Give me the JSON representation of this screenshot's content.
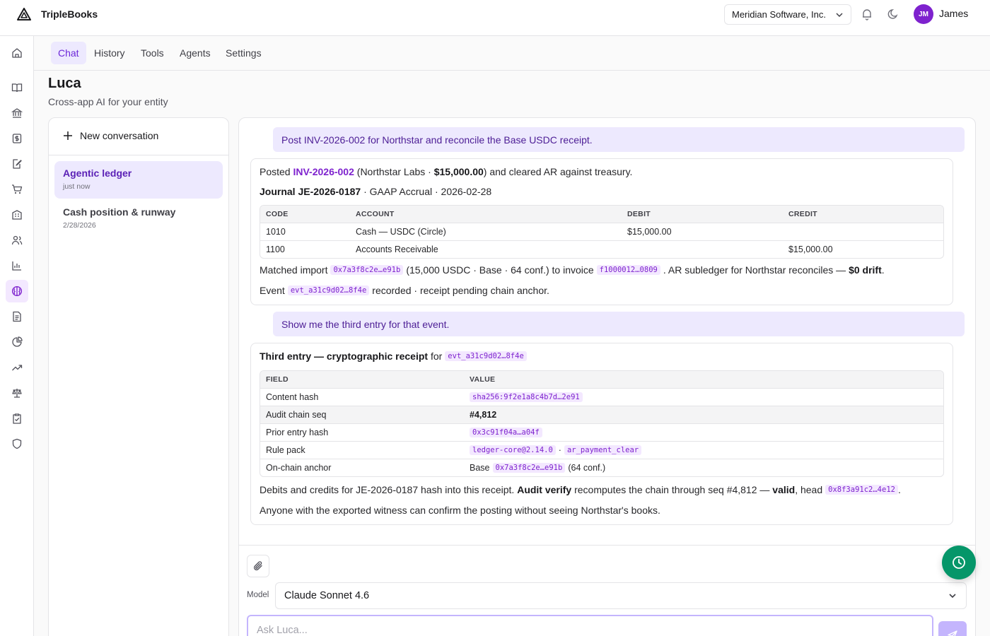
{
  "app": {
    "name": "TripleBooks"
  },
  "header": {
    "entity_selector": "Meridian Software, Inc.",
    "avatar_initials": "JM",
    "user_name": "James"
  },
  "sidebar": {
    "items": [
      {
        "icon": "home-icon"
      },
      {
        "icon": "book-icon"
      },
      {
        "icon": "bank-icon"
      },
      {
        "icon": "dollar-icon"
      },
      {
        "icon": "edit-document-icon"
      },
      {
        "icon": "cart-icon"
      },
      {
        "icon": "building-icon"
      },
      {
        "icon": "users-icon"
      },
      {
        "icon": "bar-chart-icon"
      },
      {
        "icon": "brain-icon",
        "active": true
      },
      {
        "icon": "document-icon"
      },
      {
        "icon": "pie-chart-icon"
      },
      {
        "icon": "trending-up-icon"
      },
      {
        "icon": "scale-icon"
      },
      {
        "icon": "clipboard-check-icon"
      },
      {
        "icon": "shield-icon"
      }
    ]
  },
  "tabs": [
    {
      "label": "Chat",
      "active": true
    },
    {
      "label": "History"
    },
    {
      "label": "Tools"
    },
    {
      "label": "Agents"
    },
    {
      "label": "Settings"
    }
  ],
  "page": {
    "title": "Luca",
    "subtitle": "Cross-app AI for your entity"
  },
  "conversations": {
    "new_label": "New conversation",
    "items": [
      {
        "title": "Agentic ledger",
        "meta": "just now",
        "active": true
      },
      {
        "title": "Cash position & runway",
        "meta": "2/28/2026"
      }
    ]
  },
  "chat": {
    "msg1": "Post INV-2026-002 for Northstar and reconcile the Base USDC receipt.",
    "reply1": {
      "posted_prefix": "Posted",
      "invoice": "INV-2026-002",
      "paren_open": "(Northstar Labs ·",
      "amount": "$15,000.00",
      "posted_suffix": ") and cleared AR against treasury.",
      "journal_id": "Journal JE-2026-0187",
      "journal_meta": "· GAAP Accrual · 2026-02-28",
      "table_headers": [
        "CODE",
        "ACCOUNT",
        "DEBIT",
        "CREDIT"
      ],
      "rows": [
        {
          "code": "1010",
          "account": "Cash — USDC (Circle)",
          "debit": "$15,000.00",
          "credit": ""
        },
        {
          "code": "1100",
          "account": "Accounts Receivable",
          "debit": "",
          "credit": "$15,000.00"
        }
      ],
      "matched_prefix": "Matched import",
      "matched_hash": "0x7a3f8c2e…e91b",
      "matched_mid": "(15,000 USDC · Base · 64 conf.) to invoice",
      "invoice_hash": "f1000012…0809",
      "matched_suffix": ". AR subledger for Northstar reconciles —",
      "drift": "$0 drift",
      "event_prefix": "Event",
      "event_id": "evt_a31c9d02…8f4e",
      "event_suffix": "recorded · receipt pending chain anchor."
    },
    "msg2": "Show me the third entry for that event.",
    "reply2": {
      "title": "Third entry — cryptographic receipt",
      "for_word": "for",
      "event_id": "evt_a31c9d02…8f4e",
      "table_headers": [
        "FIELD",
        "VALUE"
      ],
      "content_hash_label": "Content hash",
      "content_hash": "sha256:9f2e1a8c4b7d…2e91",
      "seq_label": "Audit chain seq",
      "seq": "#4,812",
      "prior_label": "Prior entry hash",
      "prior": "0x3c91f04a…a04f",
      "rule_label": "Rule pack",
      "rule_a": "ledger-core@2.14.0",
      "rule_sep": "·",
      "rule_b": "ar_payment_clear",
      "anchor_label": "On-chain anchor",
      "anchor_prefix": "Base",
      "anchor_hash": "0x7a3f8c2e…e91b",
      "anchor_suffix": "(64 conf.)",
      "verify_prefix": "Debits and credits for JE-2026-0187 hash into this receipt.",
      "verify_bold": "Audit verify",
      "verify_mid": "recomputes the chain through seq #4,812 —",
      "valid": "valid",
      "head_word": ", head",
      "head_hash": "0x8f3a91c2…4e12",
      "verify_end": ".",
      "closing": "Anyone with the exported witness can confirm the posting without seeing Northstar's books."
    }
  },
  "composer": {
    "model_label": "Model",
    "model_value": "Claude Sonnet 4.6",
    "placeholder": "Ask Luca..."
  },
  "colors": {
    "accent": "#7e22ce",
    "accent_soft": "#ede9fe",
    "fab": "#059669"
  }
}
